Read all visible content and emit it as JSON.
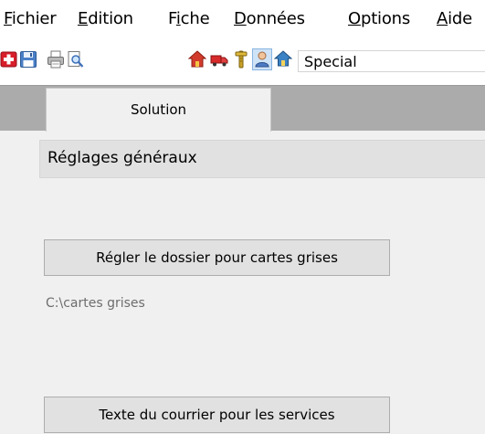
{
  "menubar": {
    "items": [
      {
        "mnemonic": "F",
        "rest": "ichier"
      },
      {
        "mnemonic": "E",
        "rest": "dition"
      },
      {
        "pre": "F",
        "mnemonic": "i",
        "rest": "che"
      },
      {
        "mnemonic": "D",
        "rest": "onnées"
      },
      {
        "mnemonic": "O",
        "rest": "ptions"
      },
      {
        "mnemonic": "A",
        "rest": "ide"
      }
    ]
  },
  "toolbar": {
    "icons": [
      "medical-cross-icon",
      "save-icon",
      "printer-icon",
      "print-preview-icon",
      "house-icon",
      "truck-icon",
      "tools-icon",
      "user-icon",
      "home-arrow-icon"
    ],
    "combo_value": "Special"
  },
  "tabs": [
    {
      "label": "Solution",
      "active": true
    }
  ],
  "section": {
    "title": "Réglages généraux"
  },
  "buttons": {
    "folder_label": "Régler le dossier pour cartes grises",
    "mail_label": "Texte du courrier pour les services"
  },
  "folder_path": "C:\\cartes grises",
  "colors": {
    "tab_strip": "#ababab",
    "window_bg": "#f0f0f0",
    "header_bg": "#e1e1e1",
    "button_bg": "#e1e1e1",
    "path_text": "#6d6d6d"
  }
}
